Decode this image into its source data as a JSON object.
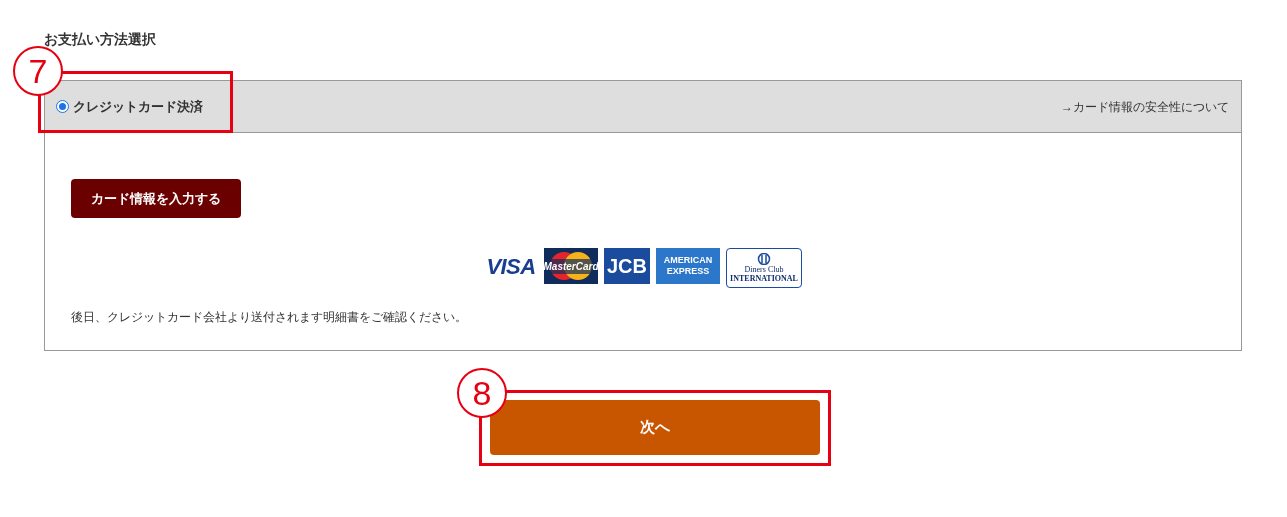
{
  "section_title": "お支払い方法選択",
  "payment_option": {
    "label": "クレジットカード決済",
    "selected": true,
    "security_link": "→カード情報の安全性について"
  },
  "card_info_button": "カード情報を入力する",
  "card_logos": [
    {
      "kind": "visa",
      "text": "VISA"
    },
    {
      "kind": "mastercard",
      "text": "MasterCard"
    },
    {
      "kind": "jcb",
      "text": "JCB"
    },
    {
      "kind": "amex",
      "text": "AMERICAN EXPRESS"
    },
    {
      "kind": "diners",
      "text": "Diners Club",
      "subtext": "INTERNATIONAL"
    }
  ],
  "note": "後日、クレジットカード会社より送付されます明細書をご確認ください。",
  "next_button": "次へ",
  "annotations": [
    {
      "label": "7"
    },
    {
      "label": "8"
    }
  ]
}
